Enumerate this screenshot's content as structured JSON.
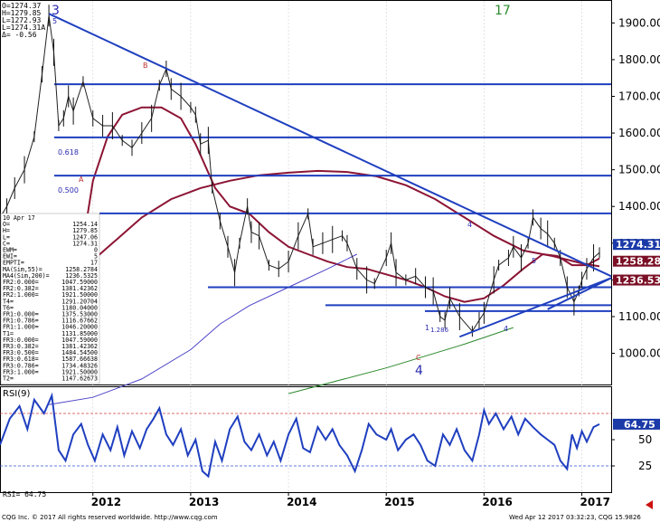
{
  "chart_data": {
    "type": "line",
    "title": "",
    "instrument_panel": {
      "lines": [
        "O=1274.37",
        "H=1279.85",
        "L=1272.93",
        "L=1274.31A",
        "Δ=  -0.56"
      ]
    },
    "wave_labels": {
      "top_left": "3",
      "top_right": "17",
      "bottom": "4",
      "markers": [
        "5",
        "B",
        "A",
        "C",
        "4",
        "4",
        "5",
        "1"
      ]
    },
    "fib_labels": {
      "l1": "0.618",
      "l2": "0.500",
      "l3": "1.286"
    },
    "price_axis": {
      "ticks": [
        {
          "value": 1000,
          "label": "1000.00"
        },
        {
          "value": 1100,
          "label": "1100.00"
        },
        {
          "value": 1200,
          "label": "1200.00"
        },
        {
          "value": 1300,
          "label": "1300.00"
        },
        {
          "value": 1400,
          "label": "1400.00"
        },
        {
          "value": 1500,
          "label": "1500.00"
        },
        {
          "value": 1600,
          "label": "1600.00"
        },
        {
          "value": 1700,
          "label": "1700.00"
        },
        {
          "value": 1800,
          "label": "1800.00"
        },
        {
          "value": 1900,
          "label": "1900.00"
        }
      ],
      "ylim": [
        915,
        1960
      ],
      "badges": [
        {
          "label": "1274.31",
          "value": 1274.31,
          "color": "#1b3aa8"
        },
        {
          "label": "1258.28",
          "value": 1258.28,
          "color": "#7a0f25"
        },
        {
          "label": "1236.53",
          "value": 1236.53,
          "color": "#7a0f25"
        }
      ]
    },
    "time_axis": {
      "labels": [
        {
          "label": "2012",
          "t": 2012.0
        },
        {
          "label": "2013",
          "t": 2013.0
        },
        {
          "label": "2014",
          "t": 2014.0
        },
        {
          "label": "2015",
          "t": 2015.0
        },
        {
          "label": "2016",
          "t": 2016.0
        },
        {
          "label": "2017",
          "t": 2017.0
        }
      ],
      "xlim": [
        2011.05,
        2017.3
      ]
    },
    "horizontal_levels": [
      1733,
      1588,
      1484,
      1381,
      1180,
      1131,
      1115
    ],
    "trendlines": [
      {
        "from": [
          2011.55,
          1925
        ],
        "to": [
          2017.3,
          1210
        ]
      },
      {
        "from": [
          2015.75,
          1045
        ],
        "to": [
          2017.3,
          1205
        ]
      },
      {
        "from": [
          2016.65,
          1120
        ],
        "to": [
          2017.3,
          1205
        ]
      }
    ],
    "price_series": {
      "name": "",
      "points": [
        [
          2011.05,
          1370
        ],
        [
          2011.12,
          1400
        ],
        [
          2011.2,
          1450
        ],
        [
          2011.3,
          1500
        ],
        [
          2011.4,
          1590
        ],
        [
          2011.48,
          1760
        ],
        [
          2011.55,
          1920
        ],
        [
          2011.6,
          1820
        ],
        [
          2011.65,
          1620
        ],
        [
          2011.7,
          1640
        ],
        [
          2011.75,
          1700
        ],
        [
          2011.8,
          1660
        ],
        [
          2011.9,
          1740
        ],
        [
          2012.0,
          1640
        ],
        [
          2012.1,
          1620
        ],
        [
          2012.2,
          1620
        ],
        [
          2012.3,
          1580
        ],
        [
          2012.4,
          1560
        ],
        [
          2012.5,
          1600
        ],
        [
          2012.6,
          1640
        ],
        [
          2012.68,
          1730
        ],
        [
          2012.75,
          1775
        ],
        [
          2012.8,
          1720
        ],
        [
          2012.9,
          1700
        ],
        [
          2013.0,
          1670
        ],
        [
          2013.05,
          1650
        ],
        [
          2013.1,
          1570
        ],
        [
          2013.18,
          1580
        ],
        [
          2013.22,
          1450
        ],
        [
          2013.3,
          1360
        ],
        [
          2013.38,
          1290
        ],
        [
          2013.45,
          1220
        ],
        [
          2013.5,
          1300
        ],
        [
          2013.58,
          1400
        ],
        [
          2013.62,
          1330
        ],
        [
          2013.7,
          1320
        ],
        [
          2013.8,
          1240
        ],
        [
          2013.9,
          1230
        ],
        [
          2014.0,
          1250
        ],
        [
          2014.1,
          1320
        ],
        [
          2014.2,
          1380
        ],
        [
          2014.25,
          1290
        ],
        [
          2014.35,
          1300
        ],
        [
          2014.45,
          1310
        ],
        [
          2014.55,
          1320
        ],
        [
          2014.6,
          1300
        ],
        [
          2014.7,
          1230
        ],
        [
          2014.8,
          1200
        ],
        [
          2014.88,
          1190
        ],
        [
          2015.0,
          1260
        ],
        [
          2015.05,
          1300
        ],
        [
          2015.1,
          1220
        ],
        [
          2015.2,
          1200
        ],
        [
          2015.3,
          1210
        ],
        [
          2015.4,
          1180
        ],
        [
          2015.48,
          1170
        ],
        [
          2015.55,
          1100
        ],
        [
          2015.6,
          1090
        ],
        [
          2015.65,
          1150
        ],
        [
          2015.75,
          1100
        ],
        [
          2015.88,
          1060
        ],
        [
          2015.95,
          1090
        ],
        [
          2016.0,
          1110
        ],
        [
          2016.1,
          1200
        ],
        [
          2016.15,
          1240
        ],
        [
          2016.25,
          1260
        ],
        [
          2016.3,
          1290
        ],
        [
          2016.38,
          1260
        ],
        [
          2016.45,
          1300
        ],
        [
          2016.5,
          1370
        ],
        [
          2016.58,
          1340
        ],
        [
          2016.65,
          1325
        ],
        [
          2016.72,
          1300
        ],
        [
          2016.78,
          1260
        ],
        [
          2016.85,
          1180
        ],
        [
          2016.92,
          1140
        ],
        [
          2016.97,
          1170
        ],
        [
          2017.0,
          1200
        ],
        [
          2017.05,
          1230
        ],
        [
          2017.12,
          1260
        ],
        [
          2017.18,
          1274
        ]
      ]
    },
    "moving_averages": [
      {
        "name": "",
        "color": "#8c1434",
        "points": [
          [
            2011.9,
            1300
          ],
          [
            2012.0,
            1470
          ],
          [
            2012.15,
            1590
          ],
          [
            2012.3,
            1650
          ],
          [
            2012.5,
            1670
          ],
          [
            2012.7,
            1670
          ],
          [
            2012.9,
            1640
          ],
          [
            2013.05,
            1570
          ],
          [
            2013.25,
            1450
          ],
          [
            2013.4,
            1400
          ],
          [
            2013.6,
            1380
          ],
          [
            2013.8,
            1330
          ],
          [
            2014.0,
            1290
          ],
          [
            2014.2,
            1270
          ],
          [
            2014.4,
            1250
          ],
          [
            2014.6,
            1235
          ],
          [
            2014.8,
            1230
          ],
          [
            2015.0,
            1215
          ],
          [
            2015.2,
            1200
          ],
          [
            2015.4,
            1180
          ],
          [
            2015.6,
            1155
          ],
          [
            2015.8,
            1140
          ],
          [
            2016.0,
            1150
          ],
          [
            2016.2,
            1185
          ],
          [
            2016.4,
            1230
          ],
          [
            2016.6,
            1270
          ],
          [
            2016.75,
            1265
          ],
          [
            2016.9,
            1240
          ],
          [
            2017.05,
            1240
          ],
          [
            2017.18,
            1258
          ]
        ]
      },
      {
        "name": "",
        "color": "#8c1434",
        "points": [
          [
            2011.9,
            1230
          ],
          [
            2012.2,
            1300
          ],
          [
            2012.5,
            1370
          ],
          [
            2012.8,
            1420
          ],
          [
            2013.1,
            1450
          ],
          [
            2013.4,
            1470
          ],
          [
            2013.7,
            1485
          ],
          [
            2014.0,
            1492
          ],
          [
            2014.3,
            1497
          ],
          [
            2014.6,
            1494
          ],
          [
            2014.9,
            1482
          ],
          [
            2015.2,
            1458
          ],
          [
            2015.5,
            1420
          ],
          [
            2015.8,
            1370
          ],
          [
            2016.1,
            1320
          ],
          [
            2016.4,
            1280
          ],
          [
            2016.7,
            1265
          ],
          [
            2017.0,
            1245
          ],
          [
            2017.18,
            1237
          ]
        ]
      },
      {
        "name": "",
        "color": "#4d44c8",
        "points": [
          [
            2011.55,
            860
          ],
          [
            2012.0,
            880
          ],
          [
            2012.5,
            930
          ],
          [
            2013.0,
            1010
          ],
          [
            2013.3,
            1080
          ],
          [
            2013.6,
            1130
          ],
          [
            2014.0,
            1180
          ],
          [
            2014.4,
            1230
          ],
          [
            2014.7,
            1270
          ]
        ]
      },
      {
        "name": "",
        "color": "#2c8a2c",
        "points": [
          [
            2014.0,
            890
          ],
          [
            2015.0,
            960
          ],
          [
            2015.8,
            1025
          ],
          [
            2016.3,
            1070
          ]
        ]
      }
    ],
    "info_box": {
      "lines": [
        [
          "10 Apr 17",
          ""
        ],
        [
          "O=",
          "1254.14"
        ],
        [
          "H=",
          "1279.85"
        ],
        [
          "L=",
          "1247.06"
        ],
        [
          "C=",
          "1274.31"
        ],
        [
          "EWM=",
          "0"
        ],
        [
          "EWI=",
          "5"
        ],
        [
          "EMPTI=",
          "17"
        ],
        [
          "MA(Sim,55)=",
          "1258.2784"
        ],
        [
          "MA4(Sim,200)=",
          "1236.5325"
        ],
        [
          "FR2:0.000=",
          "1047.59000"
        ],
        [
          "FR2:0.382=",
          "1381.42362"
        ],
        [
          "FR2:1.000=",
          "1921.50000"
        ],
        [
          "T4=",
          "1291.20704"
        ],
        [
          "T6=",
          "1180.04000"
        ],
        [
          "FR1:0.000=",
          "1375.53000"
        ],
        [
          "FR1:0.786=",
          "1116.67662"
        ],
        [
          "FR1:1.000=",
          "1046.20000"
        ],
        [
          "T1=",
          "1131.85000"
        ],
        [
          "FR3:0.000=",
          "1047.59000"
        ],
        [
          "FR3:0.382=",
          "1381.42362"
        ],
        [
          "FR3:0.500=",
          "1484.54500"
        ],
        [
          "FR3:0.618=",
          "1587.66638"
        ],
        [
          "FR3:0.786=",
          "1734.48326"
        ],
        [
          "FR3:1.000=",
          "1921.50000"
        ],
        [
          "T2=",
          "1147.62673"
        ]
      ]
    },
    "rsi": {
      "title": "RSI(9)",
      "readout": "RSI=   64.75",
      "ylim": [
        0,
        100
      ],
      "overbought": 75,
      "oversold": 25,
      "ticks": [
        {
          "value": 25,
          "label": "25"
        },
        {
          "value": 50,
          "label": "50"
        }
      ],
      "badge": {
        "label": "64.75",
        "value": 64.75
      },
      "points": [
        [
          2011.05,
          45
        ],
        [
          2011.15,
          70
        ],
        [
          2011.25,
          82
        ],
        [
          2011.33,
          60
        ],
        [
          2011.4,
          88
        ],
        [
          2011.5,
          75
        ],
        [
          2011.58,
          92
        ],
        [
          2011.65,
          40
        ],
        [
          2011.72,
          30
        ],
        [
          2011.8,
          55
        ],
        [
          2011.88,
          65
        ],
        [
          2011.95,
          45
        ],
        [
          2012.02,
          30
        ],
        [
          2012.1,
          55
        ],
        [
          2012.18,
          40
        ],
        [
          2012.25,
          62
        ],
        [
          2012.32,
          35
        ],
        [
          2012.4,
          58
        ],
        [
          2012.48,
          42
        ],
        [
          2012.55,
          60
        ],
        [
          2012.62,
          70
        ],
        [
          2012.68,
          80
        ],
        [
          2012.75,
          55
        ],
        [
          2012.82,
          45
        ],
        [
          2012.9,
          60
        ],
        [
          2012.97,
          35
        ],
        [
          2013.05,
          50
        ],
        [
          2013.12,
          20
        ],
        [
          2013.18,
          15
        ],
        [
          2013.25,
          48
        ],
        [
          2013.32,
          30
        ],
        [
          2013.4,
          60
        ],
        [
          2013.48,
          72
        ],
        [
          2013.55,
          48
        ],
        [
          2013.62,
          40
        ],
        [
          2013.7,
          55
        ],
        [
          2013.78,
          35
        ],
        [
          2013.85,
          48
        ],
        [
          2013.92,
          30
        ],
        [
          2014.0,
          55
        ],
        [
          2014.08,
          70
        ],
        [
          2014.15,
          42
        ],
        [
          2014.22,
          38
        ],
        [
          2014.3,
          62
        ],
        [
          2014.38,
          50
        ],
        [
          2014.45,
          60
        ],
        [
          2014.52,
          45
        ],
        [
          2014.6,
          35
        ],
        [
          2014.68,
          20
        ],
        [
          2014.75,
          40
        ],
        [
          2014.82,
          65
        ],
        [
          2014.9,
          55
        ],
        [
          2015.0,
          50
        ],
        [
          2015.05,
          60
        ],
        [
          2015.12,
          40
        ],
        [
          2015.2,
          50
        ],
        [
          2015.28,
          55
        ],
        [
          2015.35,
          45
        ],
        [
          2015.42,
          30
        ],
        [
          2015.5,
          25
        ],
        [
          2015.58,
          55
        ],
        [
          2015.65,
          45
        ],
        [
          2015.72,
          60
        ],
        [
          2015.8,
          40
        ],
        [
          2015.88,
          30
        ],
        [
          2015.95,
          55
        ],
        [
          2016.0,
          78
        ],
        [
          2016.05,
          65
        ],
        [
          2016.12,
          75
        ],
        [
          2016.2,
          60
        ],
        [
          2016.28,
          72
        ],
        [
          2016.35,
          55
        ],
        [
          2016.42,
          70
        ],
        [
          2016.5,
          62
        ],
        [
          2016.58,
          55
        ],
        [
          2016.65,
          50
        ],
        [
          2016.72,
          45
        ],
        [
          2016.78,
          30
        ],
        [
          2016.85,
          22
        ],
        [
          2016.9,
          55
        ],
        [
          2016.95,
          42
        ],
        [
          2017.0,
          58
        ],
        [
          2017.05,
          48
        ],
        [
          2017.12,
          62
        ],
        [
          2017.18,
          64.75
        ]
      ]
    },
    "footer": {
      "copyright": "CQG Inc. © 2017 All rights reserved worldwide. http://www.cqg.com",
      "timestamp": "Wed Apr 12 2017 03:32:23, CQG 15.9826"
    }
  }
}
